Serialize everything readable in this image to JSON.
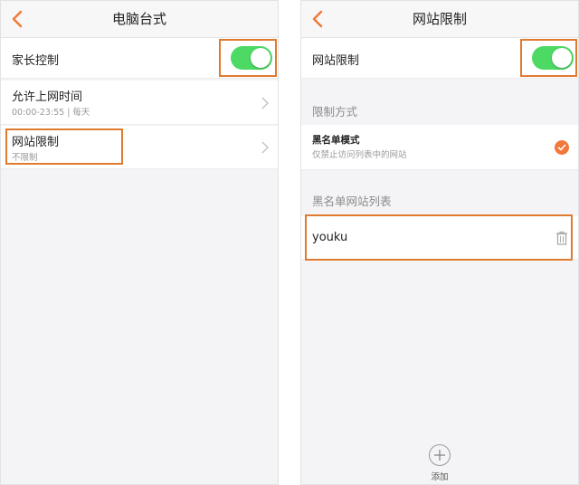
{
  "left": {
    "title": "电脑台式",
    "parental_control": {
      "label": "家长控制",
      "enabled": true
    },
    "allowed_time": {
      "label": "允许上网时间",
      "value": "00:00-23:55 | 每天"
    },
    "website_limit": {
      "label": "网站限制",
      "value": "不限制"
    }
  },
  "right": {
    "title": "网站限制",
    "website_limit": {
      "label": "网站限制",
      "enabled": true
    },
    "mode_section": {
      "label": "限制方式"
    },
    "blacklist_mode": {
      "label": "黑名单模式",
      "description": "仅禁止访问列表中的网站",
      "selected": true
    },
    "list_section": {
      "label": "黑名单网站列表"
    },
    "sites": [
      {
        "name": "youku"
      }
    ],
    "add_label": "添加"
  },
  "colors": {
    "accent": "#f07a3a",
    "toggle_on": "#4cd964",
    "highlight": "#e07a2f"
  }
}
